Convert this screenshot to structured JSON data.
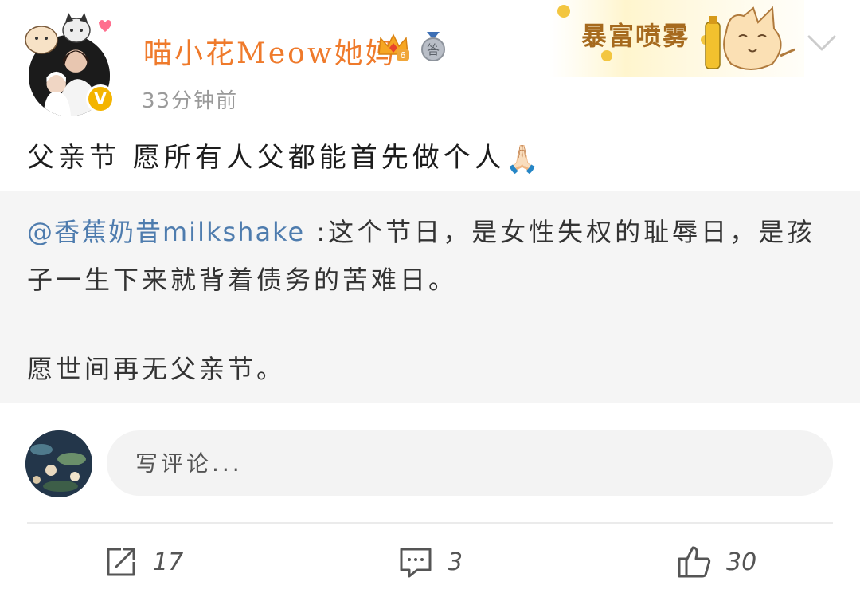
{
  "post": {
    "author": {
      "name": "喵小花Meow她妈",
      "verified_mark": "V",
      "vip_level": "6",
      "medal_text": "答"
    },
    "timestamp": "33分钟前",
    "decoration_text": "暴富喷雾",
    "text": "父亲节 愿所有人父都能首先做个人",
    "emoji": "🙏🏻",
    "retweet": {
      "mention": "@香蕉奶昔milkshake",
      "separator": " :",
      "line1_rest": "这个节日，是女性失权的耻辱日，是孩",
      "line2": "子一生下来就背着债务的苦难日。",
      "line3": "愿世间再无父亲节。"
    }
  },
  "comment_box": {
    "placeholder": "写评论..."
  },
  "actions": {
    "repost_count": "17",
    "comment_count": "3",
    "like_count": "30"
  },
  "colors": {
    "username": "#ef7a2b",
    "mention": "#4e7cae",
    "timestamp": "#9a9a9a",
    "retweet_bg": "#f5f5f5",
    "verified": "#f4b400"
  },
  "icons": {
    "repost": "repost-icon",
    "comment": "comment-icon",
    "like": "thumbs-up-icon",
    "more": "chevron-down-icon"
  }
}
